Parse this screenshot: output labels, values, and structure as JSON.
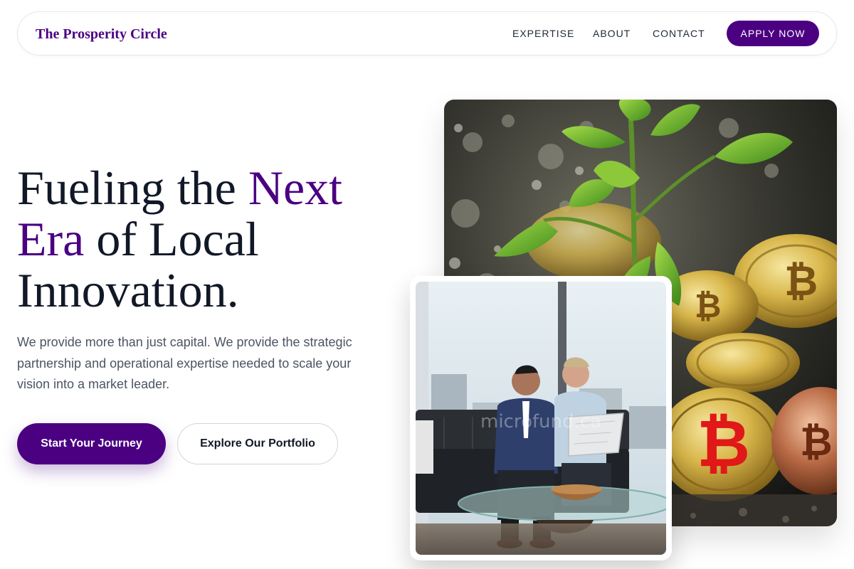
{
  "nav": {
    "brand": "The Prosperity Circle",
    "links": [
      "EXPERTISE",
      "ABOUT",
      "CONTACT"
    ],
    "cta": "APPLY NOW"
  },
  "hero": {
    "title_part1": "Fueling the ",
    "title_accent1": "Next",
    "title_accent2": "Era",
    "title_part2": " of Local Innovation.",
    "description": "We provide more than just capital. We provide the strategic partnership and operational expertise needed to scale your vision into a market leader.",
    "primary_button": "Start Your Journey",
    "secondary_button": "Explore Our Portfolio"
  },
  "images": {
    "main_alt": "plant-sprout-with-bitcoin-coins-photo",
    "inset_alt": "two-businessmen-with-laptop-on-sofa-photo",
    "watermark": "microfund.ca"
  },
  "colors": {
    "brand_purple": "#4b0082",
    "text_dark": "#111827",
    "text_muted": "#4b5563"
  }
}
